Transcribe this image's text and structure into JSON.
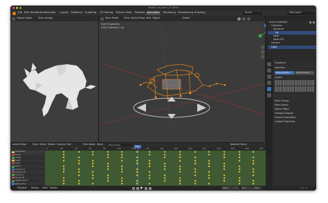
{
  "window": {
    "title": "beagle_cat_base_01.blend"
  },
  "menu": {
    "items": [
      "File",
      "Edit",
      "Render",
      "Window",
      "Help"
    ],
    "tabs": [
      "Layout",
      "Modeling",
      "Sculpting",
      "UV Editing",
      "Texture Paint",
      "Shading",
      "Animation",
      "Rendering",
      "Compositing",
      "Scripting"
    ],
    "active_tab": "Animation",
    "scene_label": "Scene",
    "view_layer_label": "View Layer"
  },
  "image_editor": {
    "header_items": [
      "View",
      "Image"
    ],
    "mode_label": "Object Mode"
  },
  "viewport": {
    "header_items": [
      "View",
      "Select",
      "Pose",
      "Add",
      "Object"
    ],
    "mode_label": "Pose Mode",
    "shading_label": "Global",
    "info_line1": "User Perspective",
    "info_line2": "(143) Collection | rig"
  },
  "outliner": {
    "items": [
      "Scene Collection",
      "Collection",
      "Armature",
      "rig",
      "Mesh",
      "Mesh.001",
      "Camera",
      "Light"
    ]
  },
  "properties": {
    "sections": [
      "Transform",
      "Selection",
      "Bone Groups",
      "Pose Library",
      "Motion Paths",
      "Viewport Display",
      "Inverse Kinematics",
      "Custom Properties"
    ],
    "buttons": [
      "Pose Position",
      "Rest Position"
    ],
    "layers_label": "Layers"
  },
  "timeline": {
    "header_items": [
      "View",
      "Select",
      "Marker",
      "Channel",
      "Key"
    ],
    "mode_label": "Action Editor",
    "action_name": "Pose Action",
    "push_down_label": "Push Down",
    "stash_label": "Stash",
    "channels": [
      "Summary",
      "torso",
      "chest",
      "head",
      "neck",
      "tail_1",
      "hand_ik.L",
      "hand_ik.R",
      "foot_ik.L",
      "foot_ik.R",
      "upper_arm.L",
      "spine_fk.1"
    ],
    "channel_colors": [
      "#d6b85a",
      "#b04848",
      "#4aa14a",
      "#d6b85a",
      "#b04848",
      "#4aa14a",
      "#3a77c8",
      "#b04848",
      "#4aa14a",
      "#b04848",
      "#4aa14a",
      "#3a77c8"
    ],
    "ruler": [
      "0",
      "20",
      "40",
      "60",
      "80",
      "100",
      "120",
      "140",
      "160",
      "180",
      "200",
      "220",
      "240",
      "260",
      "280",
      "300"
    ],
    "current_frame": "143",
    "interpolation_label": "Nearest Frame"
  },
  "playback": {
    "items": [
      "Playback",
      "Keying",
      "View",
      "Marker"
    ],
    "start": "1",
    "end": "250",
    "start_label": "Start",
    "end_label": "End"
  },
  "status": {
    "version": "2.80.75"
  },
  "icons": [
    "close-icon",
    "minimize-icon",
    "maximize-icon",
    "play-icon",
    "eye-icon",
    "camera-icon",
    "render-icon",
    "gizmo-icon"
  ]
}
